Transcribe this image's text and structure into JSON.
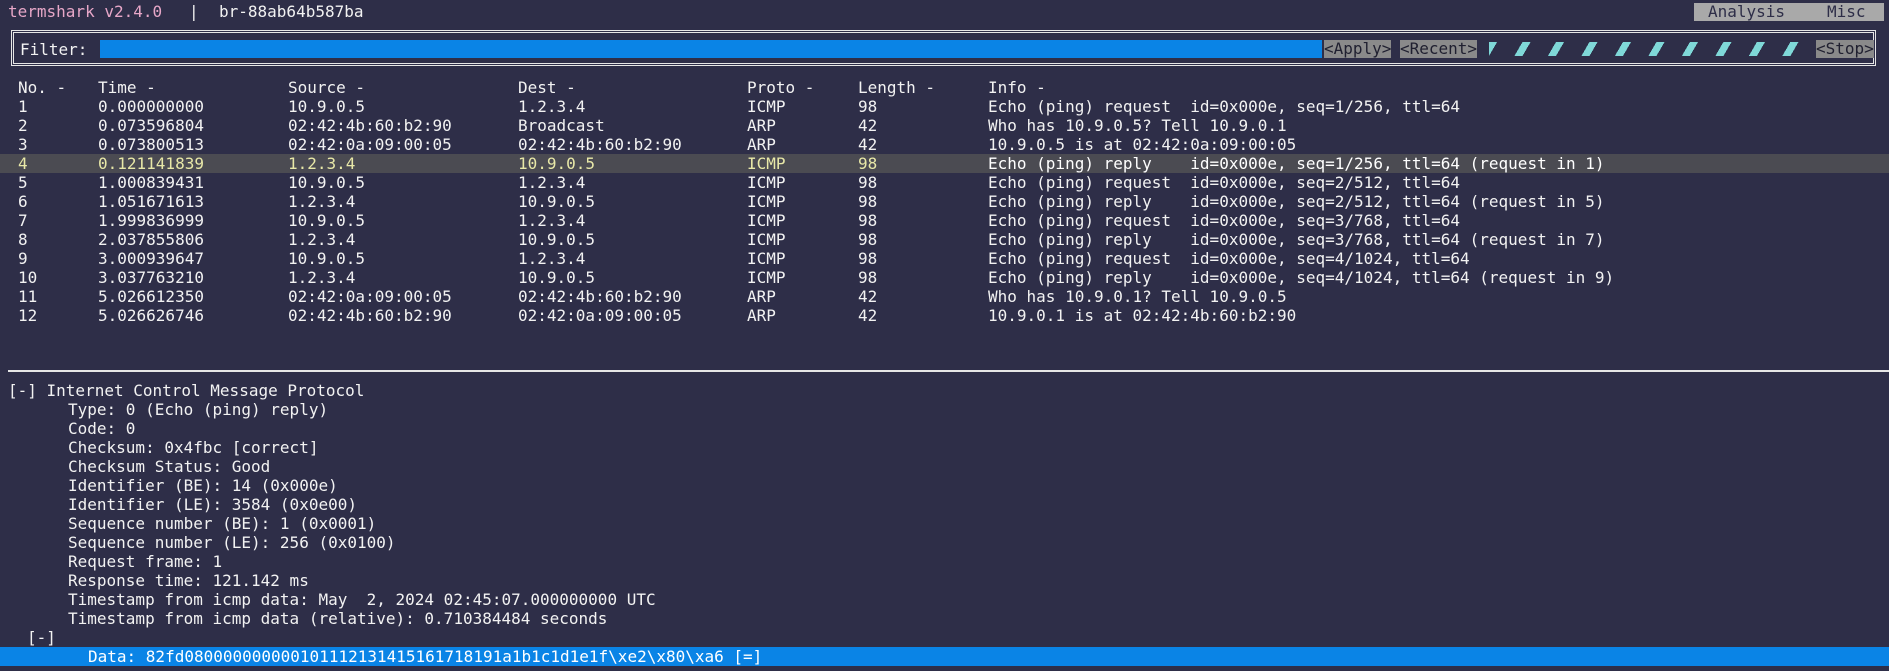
{
  "titlebar": {
    "app_title": "termshark v2.4.0",
    "separator": "|",
    "interface": "br-88ab64b587ba",
    "menu": {
      "analysis": "Analysis",
      "misc": "Misc"
    }
  },
  "filter": {
    "label": "Filter:",
    "value": "",
    "apply_label": "<Apply>",
    "recent_label": "<Recent>",
    "stop_label": "<Stop>"
  },
  "packet_list": {
    "headers": {
      "no": "No. -",
      "time": "Time -",
      "source": "Source -",
      "dest": "Dest -",
      "proto": "Proto -",
      "length": "Length -",
      "info": "Info -"
    },
    "rows": [
      {
        "no": "1",
        "time": "0.000000000",
        "source": "10.9.0.5",
        "dest": "1.2.3.4",
        "proto": "ICMP",
        "length": "98",
        "info": "Echo (ping) request  id=0x000e, seq=1/256, ttl=64"
      },
      {
        "no": "2",
        "time": "0.073596804",
        "source": "02:42:4b:60:b2:90",
        "dest": "Broadcast",
        "proto": "ARP",
        "length": "42",
        "info": "Who has 10.9.0.5? Tell 10.9.0.1"
      },
      {
        "no": "3",
        "time": "0.073800513",
        "source": "02:42:0a:09:00:05",
        "dest": "02:42:4b:60:b2:90",
        "proto": "ARP",
        "length": "42",
        "info": "10.9.0.5 is at 02:42:0a:09:00:05"
      },
      {
        "no": "4",
        "time": "0.121141839",
        "source": "1.2.3.4",
        "dest": "10.9.0.5",
        "proto": "ICMP",
        "length": "98",
        "info": "Echo (ping) reply    id=0x000e, seq=1/256, ttl=64 (request in 1)",
        "selected": true
      },
      {
        "no": "5",
        "time": "1.000839431",
        "source": "10.9.0.5",
        "dest": "1.2.3.4",
        "proto": "ICMP",
        "length": "98",
        "info": "Echo (ping) request  id=0x000e, seq=2/512, ttl=64"
      },
      {
        "no": "6",
        "time": "1.051671613",
        "source": "1.2.3.4",
        "dest": "10.9.0.5",
        "proto": "ICMP",
        "length": "98",
        "info": "Echo (ping) reply    id=0x000e, seq=2/512, ttl=64 (request in 5)"
      },
      {
        "no": "7",
        "time": "1.999836999",
        "source": "10.9.0.5",
        "dest": "1.2.3.4",
        "proto": "ICMP",
        "length": "98",
        "info": "Echo (ping) request  id=0x000e, seq=3/768, ttl=64"
      },
      {
        "no": "8",
        "time": "2.037855806",
        "source": "1.2.3.4",
        "dest": "10.9.0.5",
        "proto": "ICMP",
        "length": "98",
        "info": "Echo (ping) reply    id=0x000e, seq=3/768, ttl=64 (request in 7)"
      },
      {
        "no": "9",
        "time": "3.000939647",
        "source": "10.9.0.5",
        "dest": "1.2.3.4",
        "proto": "ICMP",
        "length": "98",
        "info": "Echo (ping) request  id=0x000e, seq=4/1024, ttl=64"
      },
      {
        "no": "10",
        "time": "3.037763210",
        "source": "1.2.3.4",
        "dest": "10.9.0.5",
        "proto": "ICMP",
        "length": "98",
        "info": "Echo (ping) reply    id=0x000e, seq=4/1024, ttl=64 (request in 9)"
      },
      {
        "no": "11",
        "time": "5.026612350",
        "source": "02:42:0a:09:00:05",
        "dest": "02:42:4b:60:b2:90",
        "proto": "ARP",
        "length": "42",
        "info": "Who has 10.9.0.1? Tell 10.9.0.5"
      },
      {
        "no": "12",
        "time": "5.026626746",
        "source": "02:42:4b:60:b2:90",
        "dest": "02:42:0a:09:00:05",
        "proto": "ARP",
        "length": "42",
        "info": "10.9.0.1 is at 02:42:4b:60:b2:90"
      }
    ]
  },
  "details": {
    "root": "[-] Internet Control Message Protocol",
    "fields": [
      "Type: 0 (Echo (ping) reply)",
      "Code: 0",
      "Checksum: 0x4fbc [correct]",
      "Checksum Status: Good",
      "Identifier (BE): 14 (0x000e)",
      "Identifier (LE): 3584 (0x0e00)",
      "Sequence number (BE): 1 (0x0001)",
      "Sequence number (LE): 256 (0x0100)",
      "Request frame: 1",
      "Response time: 121.142 ms",
      "Timestamp from icmp data: May  2, 2024 02:45:07.000000000 UTC",
      "Timestamp from icmp data (relative): 0.710384484 seconds"
    ],
    "sub_toggle": "[-]",
    "data_line": "Data: 82fd08000000000010111213141516171819 1a1b1c1d1e1f\\xe2\\x80\\xa6 [=]"
  },
  "colors": {
    "background": "#2e2e48",
    "accent_blue": "#0a84e6",
    "title_pink": "#e7a7c8",
    "selected_row": "#4b4b52",
    "progress_teal": "#7fd8d8"
  }
}
